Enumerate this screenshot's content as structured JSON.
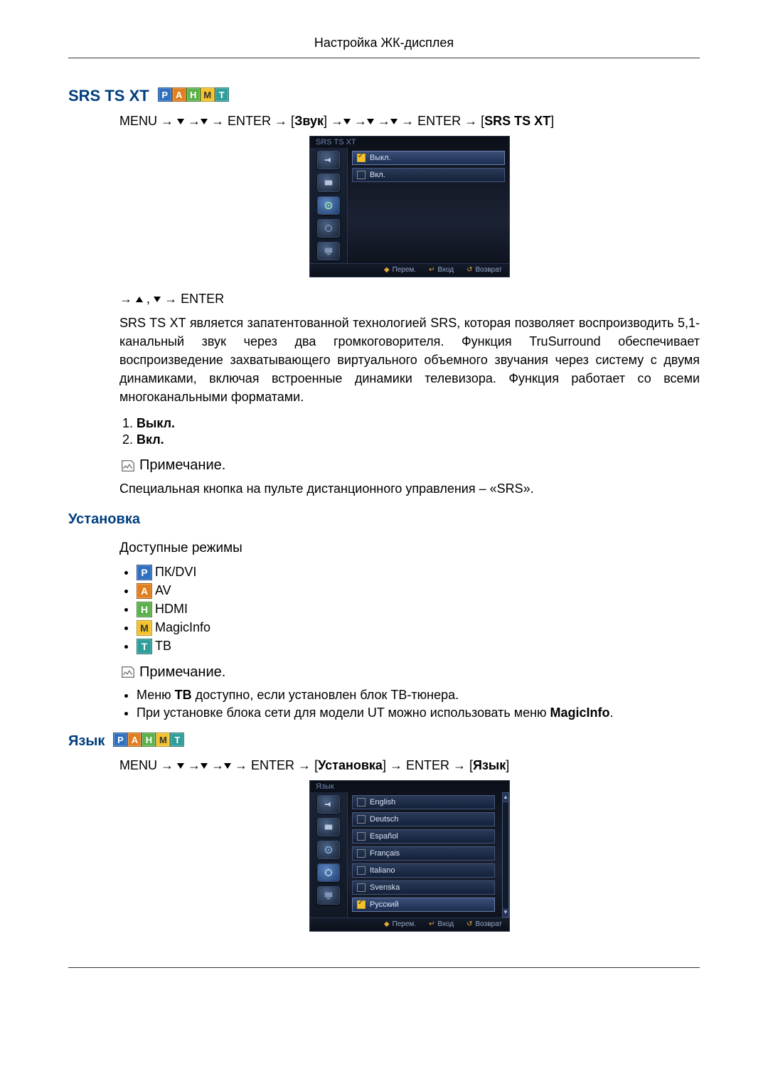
{
  "header": {
    "title": "Настройка ЖК-дисплея"
  },
  "section1": {
    "title": "SRS TS XT",
    "nav1_a": "MENU → ",
    "nav1_b": " →",
    "nav1_c": " → ENTER → ",
    "nav1_bracket_open": "[",
    "nav1_sound": "Звук",
    "nav1_bracket_close": "]",
    "nav1_d": " →",
    "nav1_e": "→",
    "nav1_f": "→",
    "nav1_g": "→ ENTER → ",
    "nav1_target_open": "[",
    "nav1_target": "SRS TS XT",
    "nav1_target_close": "]",
    "nav2_a": "→ ",
    "nav2_b": " , ",
    "nav2_c": " → ENTER",
    "description": "SRS TS XT является запатентованной технологией SRS, которая позволяет воспроизводить 5,1-канальный звук через два громкоговорителя. Функция TruSurround обеспечивает воспроизведение захватывающего виртуального объемного звучания через систему с двумя динамиками, включая встроенные динамики телевизора. Функция работает со всеми многоканальными форматами.",
    "options": [
      "Выкл.",
      "Вкл."
    ],
    "note_label": "Примечание.",
    "note_text": "Специальная кнопка на пульте дистанционного управления – «SRS».",
    "osd": {
      "title": "SRS TS XT",
      "items": [
        "Выкл.",
        "Вкл."
      ],
      "selected_index": 0,
      "footer": {
        "move": "Перем.",
        "enter": "Вход",
        "return": "Возврат"
      }
    }
  },
  "section2": {
    "title": "Установка",
    "modes_title": "Доступные режимы",
    "modes": [
      {
        "badge": "P",
        "label": "ПК/DVI"
      },
      {
        "badge": "A",
        "label": "AV"
      },
      {
        "badge": "H",
        "label": "HDMI"
      },
      {
        "badge": "M",
        "label": "MagicInfo"
      },
      {
        "badge": "T",
        "label": "ТВ"
      }
    ],
    "note_label": "Примечание.",
    "bullets": [
      {
        "pre": "Меню ",
        "bold1": "TB",
        "mid": " доступно, если установлен блок ТВ-тюнера."
      },
      {
        "pre": "При установке блока сети для модели UT можно использовать меню ",
        "bold1": "MagicInfo",
        "mid": "."
      }
    ]
  },
  "section3": {
    "title": "Язык",
    "nav_a": "MENU → ",
    "nav_b": " →",
    "nav_c": " →",
    "nav_d": " → ENTER → ",
    "nav_bracket_open": "[",
    "nav_setup": "Установка",
    "nav_bracket_close": "]",
    "nav_e": " → ENTER → ",
    "nav_target_open": "[",
    "nav_target": "Язык",
    "nav_target_close": "]",
    "osd": {
      "title": "Язык",
      "items": [
        "English",
        "Deutsch",
        "Español",
        "Français",
        "Italiano",
        "Svenska",
        "Русский"
      ],
      "selected_index": 6,
      "footer": {
        "move": "Перем.",
        "enter": "Вход",
        "return": "Возврат"
      }
    }
  }
}
